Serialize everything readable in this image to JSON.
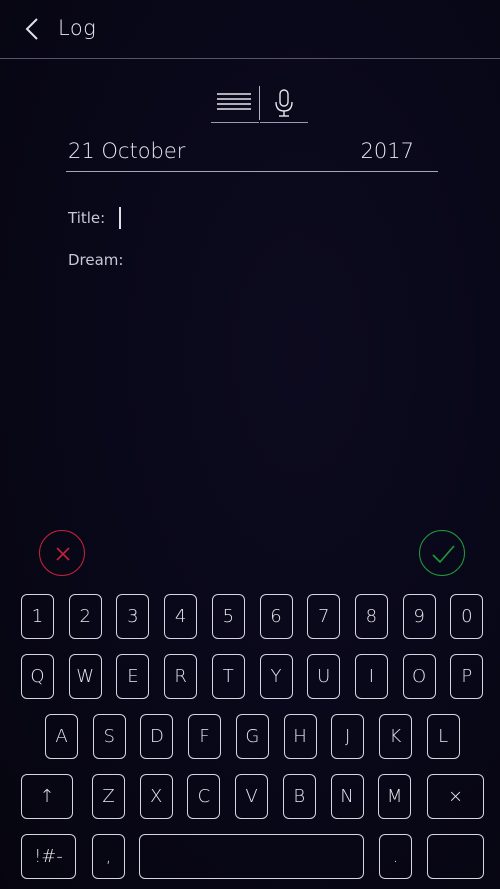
{
  "header": {
    "title": "Log"
  },
  "entry": {
    "date_day": "21 October",
    "date_year": "2017",
    "title_label": "Title:",
    "dream_label": "Dream:"
  },
  "actions": {
    "cancel_color": "#c4213a",
    "confirm_color": "#1f9b3a"
  },
  "keyboard": {
    "row_numbers": [
      "1",
      "2",
      "3",
      "4",
      "5",
      "6",
      "7",
      "8",
      "9",
      "0"
    ],
    "row_qwerty": [
      "Q",
      "W",
      "E",
      "R",
      "T",
      "Y",
      "U",
      "I",
      "O",
      "P"
    ],
    "row_asdf": [
      "A",
      "S",
      "D",
      "F",
      "G",
      "H",
      "J",
      "K",
      "L"
    ],
    "row_zxcv": [
      "Z",
      "X",
      "C",
      "V",
      "B",
      "N",
      "M"
    ],
    "shift": "↑",
    "delete": "×",
    "symbols": "!#-",
    "comma": ",",
    "space": "",
    "period": ".",
    "enter": ""
  }
}
